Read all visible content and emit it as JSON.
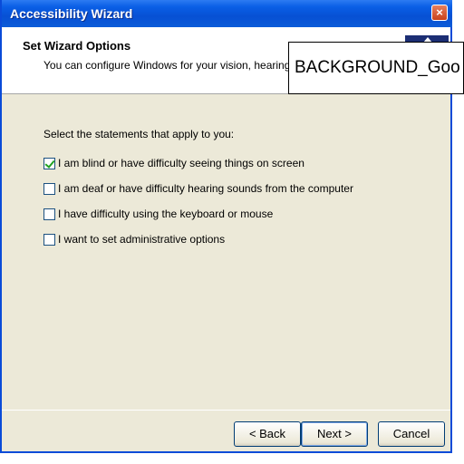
{
  "window": {
    "title": "Accessibility Wizard",
    "close_symbol": "×"
  },
  "header": {
    "title": "Set Wizard Options",
    "subtitle": "You can configure Windows for your vision, hearing, and mobility needs.",
    "icon": "wizard-icon"
  },
  "overlay": {
    "text": "BACKGROUND_Goo"
  },
  "body": {
    "prompt": "Select the statements that apply to you:",
    "options": [
      {
        "label": "I am blind or have difficulty seeing things on screen",
        "checked": true
      },
      {
        "label": "I am deaf or have difficulty hearing sounds from the computer",
        "checked": false
      },
      {
        "label": "I have difficulty using the keyboard or mouse",
        "checked": false
      },
      {
        "label": "I want to set administrative options",
        "checked": false
      }
    ]
  },
  "buttons": {
    "back": "< Back",
    "next": "Next >",
    "cancel": "Cancel"
  }
}
